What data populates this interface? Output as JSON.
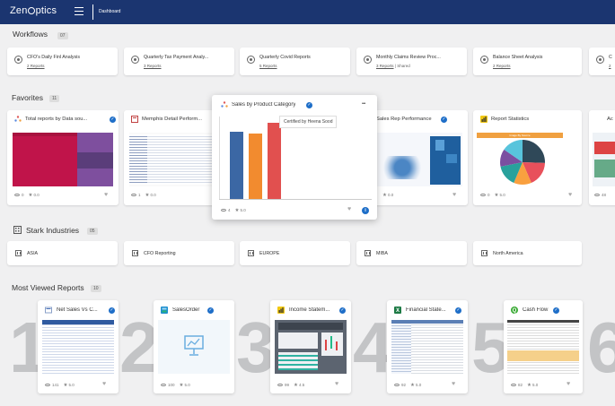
{
  "header": {
    "logo_text_left": "Zen",
    "logo_text_right": "ptics",
    "page_label": "Dashboard"
  },
  "workflows": {
    "title": "Workflows",
    "count": "07",
    "items": [
      {
        "title": "CFO's Daily Finl Analysis",
        "reports": "2 Reports",
        "shared": ""
      },
      {
        "title": "Quarterly Tax Payment Analy...",
        "reports": "3 Reports",
        "shared": ""
      },
      {
        "title": "Quarterly Covid Reports",
        "reports": "5 Reports",
        "shared": ""
      },
      {
        "title": "Monthly Claims Review Proc...",
        "reports": "3 Reports",
        "shared": "| Shared"
      },
      {
        "title": "Balance Sheet Analysis",
        "reports": "2 Reports",
        "shared": ""
      },
      {
        "title": "C",
        "reports": "2",
        "shared": ""
      }
    ]
  },
  "favorites": {
    "title": "Favorites",
    "count": "11",
    "items": [
      {
        "title": "Total reports by Data sou...",
        "views": "0",
        "rating": "0.0"
      },
      {
        "title": "Memphis Detail Perform...",
        "views": "1",
        "rating": "0.0"
      },
      {
        "title": "Sales Rep Performance",
        "views": "0",
        "rating": "0.0"
      },
      {
        "title": "Report Statistics",
        "views": "0",
        "rating": "5.0"
      },
      {
        "title": "Ac",
        "views": "48",
        "rating": ""
      }
    ],
    "popup": {
      "title": "Sales by Product Category",
      "views": "4",
      "rating": "5.0",
      "tooltip": "Certified by Heena Sood",
      "more": "•••",
      "info": "i"
    },
    "report_stats_banner": "Image By Source"
  },
  "stark": {
    "title": "Stark Industries",
    "count": "05",
    "items": [
      "ASIA",
      "CFO Reporting",
      "EUROPE",
      "MIBA",
      "North America"
    ]
  },
  "most_viewed": {
    "title": "Most Viewed Reports",
    "count": "10",
    "ranks": [
      "1",
      "2",
      "3",
      "4",
      "5",
      "6"
    ],
    "items": [
      {
        "title": "Net Sales Vs C...",
        "views": "141",
        "rating": "5.0"
      },
      {
        "title": "SalesOrder",
        "views": "100",
        "rating": "5.0"
      },
      {
        "title": "Income Statem...",
        "views": "99",
        "rating": "4.5"
      },
      {
        "title": "Financial State...",
        "views": "92",
        "rating": "5.0"
      },
      {
        "title": "Cash Flow",
        "views": "82",
        "rating": "5.0"
      }
    ]
  },
  "colors": {
    "topbar": "#1b3570",
    "verified": "#1e6ec8",
    "heatmap_red": "#c0144a",
    "heatmap_purple": "#7e4f9e",
    "bar_blue": "#3b67a4",
    "bar_orange": "#f28b2f",
    "bar_red": "#e1504f"
  }
}
